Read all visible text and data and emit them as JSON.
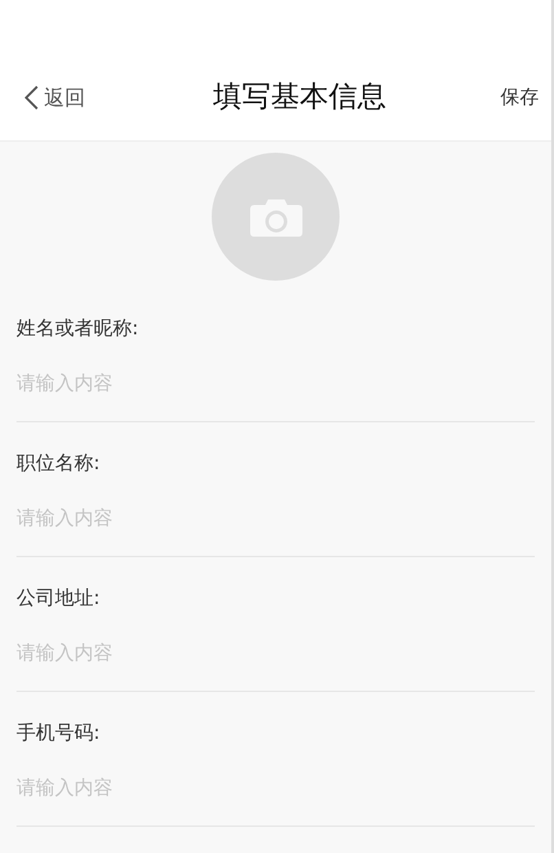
{
  "nav": {
    "back": "返回",
    "title": "填写基本信息",
    "action": "保存"
  },
  "fields": [
    {
      "label": "姓名或者昵称:",
      "placeholder": "请输入内容"
    },
    {
      "label": "职位名称:",
      "placeholder": "请输入内容"
    },
    {
      "label": "公司地址:",
      "placeholder": "请输入内容"
    },
    {
      "label": "手机号码:",
      "placeholder": "请输入内容"
    }
  ]
}
